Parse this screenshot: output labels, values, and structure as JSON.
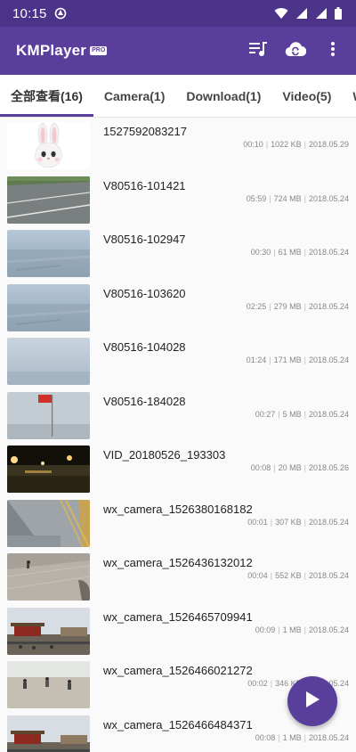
{
  "status": {
    "time": "10:15"
  },
  "app": {
    "name": "KMPlayer",
    "badge": "PRO"
  },
  "tabs": [
    {
      "label": "全部查看(16)"
    },
    {
      "label": "Camera(1)"
    },
    {
      "label": "Download(1)"
    },
    {
      "label": "Video(5)"
    },
    {
      "label": "W"
    }
  ],
  "videos": [
    {
      "title": "1527592083217",
      "duration": "00:10",
      "size": "1022 KB",
      "date": "2018.05.29",
      "thumb": "rabbit"
    },
    {
      "title": "V80516-101421",
      "duration": "05:59",
      "size": "724 MB",
      "date": "2018.05.24",
      "thumb": "road"
    },
    {
      "title": "V80516-102947",
      "duration": "00:30",
      "size": "61 MB",
      "date": "2018.05.24",
      "thumb": "aerial"
    },
    {
      "title": "V80516-103620",
      "duration": "02:25",
      "size": "279 MB",
      "date": "2018.05.24",
      "thumb": "aerial"
    },
    {
      "title": "V80516-104028",
      "duration": "01:24",
      "size": "171 MB",
      "date": "2018.05.24",
      "thumb": "sky"
    },
    {
      "title": "V80516-184028",
      "duration": "00:27",
      "size": "5 MB",
      "date": "2018.05.24",
      "thumb": "flag"
    },
    {
      "title": "VID_20180526_193303",
      "duration": "00:08",
      "size": "20 MB",
      "date": "2018.05.26",
      "thumb": "night"
    },
    {
      "title": "wx_camera_1526380168182",
      "duration": "00:01",
      "size": "307 KB",
      "date": "2018.05.24",
      "thumb": "railing"
    },
    {
      "title": "wx_camera_1526436132012",
      "duration": "00:04",
      "size": "552 KB",
      "date": "2018.05.24",
      "thumb": "plaza"
    },
    {
      "title": "wx_camera_1526465709941",
      "duration": "00:09",
      "size": "1 MB",
      "date": "2018.05.24",
      "thumb": "gate"
    },
    {
      "title": "wx_camera_1526466021272",
      "duration": "00:02",
      "size": "346 KB",
      "date": "2018.05.24",
      "thumb": "crowd"
    },
    {
      "title": "wx_camera_1526466484371",
      "duration": "00:08",
      "size": "1 MB",
      "date": "2018.05.24",
      "thumb": "gate"
    }
  ],
  "colors": {
    "statusbar": "#4a3388",
    "appbar": "#5a3e9c",
    "accent": "#5a3e9c"
  },
  "icons": [
    "wifi-icon",
    "signal-icon",
    "battery-icon",
    "playlist-icon",
    "cloud-sync-icon",
    "more-vert-icon",
    "play-icon"
  ]
}
